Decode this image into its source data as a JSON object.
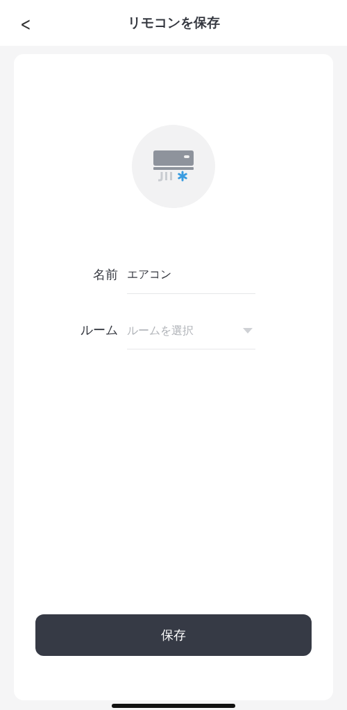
{
  "header": {
    "back": "<",
    "title": "リモコンを保存"
  },
  "form": {
    "fields": [
      {
        "kind": "text",
        "label": "名前",
        "value": "エアコン"
      },
      {
        "kind": "select",
        "label": "ルーム",
        "placeholder": "ルームを選択"
      }
    ]
  },
  "save_button": "保存"
}
